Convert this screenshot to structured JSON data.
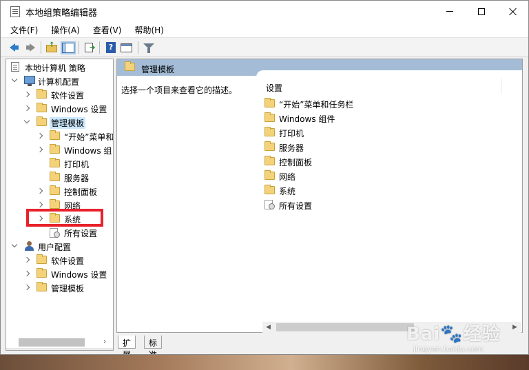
{
  "window": {
    "title": "本地组策略编辑器"
  },
  "menubar": {
    "items": [
      "文件(F)",
      "操作(A)",
      "查看(V)",
      "帮助(H)"
    ]
  },
  "tree": {
    "root": "本地计算机 策略",
    "computer_config": "计算机配置",
    "cc_software": "软件设置",
    "cc_windows": "Windows 设置",
    "cc_admin": "管理模板",
    "admin_start": "“开始”菜单和",
    "admin_windows": "Windows 组",
    "admin_printer": "打印机",
    "admin_server": "服务器",
    "admin_control": "控制面板",
    "admin_network": "网络",
    "admin_system": "系统",
    "admin_all": "所有设置",
    "user_config": "用户配置",
    "uc_software": "软件设置",
    "uc_windows": "Windows 设置",
    "uc_admin": "管理模板"
  },
  "header": {
    "title": "管理模板"
  },
  "description": "选择一个项目来查看它的描述。",
  "list": {
    "column": "设置",
    "items": [
      "“开始”菜单和任务栏",
      "Windows 组件",
      "打印机",
      "服务器",
      "控制面板",
      "网络",
      "系统",
      "所有设置"
    ]
  },
  "tabs": [
    "扩展",
    "标准"
  ],
  "watermark": {
    "main": "Bai🐾经验",
    "sub": "jingyan.baidu.com"
  },
  "colors": {
    "header_band": "#a4bcd6",
    "selection": "#cce8ff",
    "highlight": "#e8222c"
  }
}
